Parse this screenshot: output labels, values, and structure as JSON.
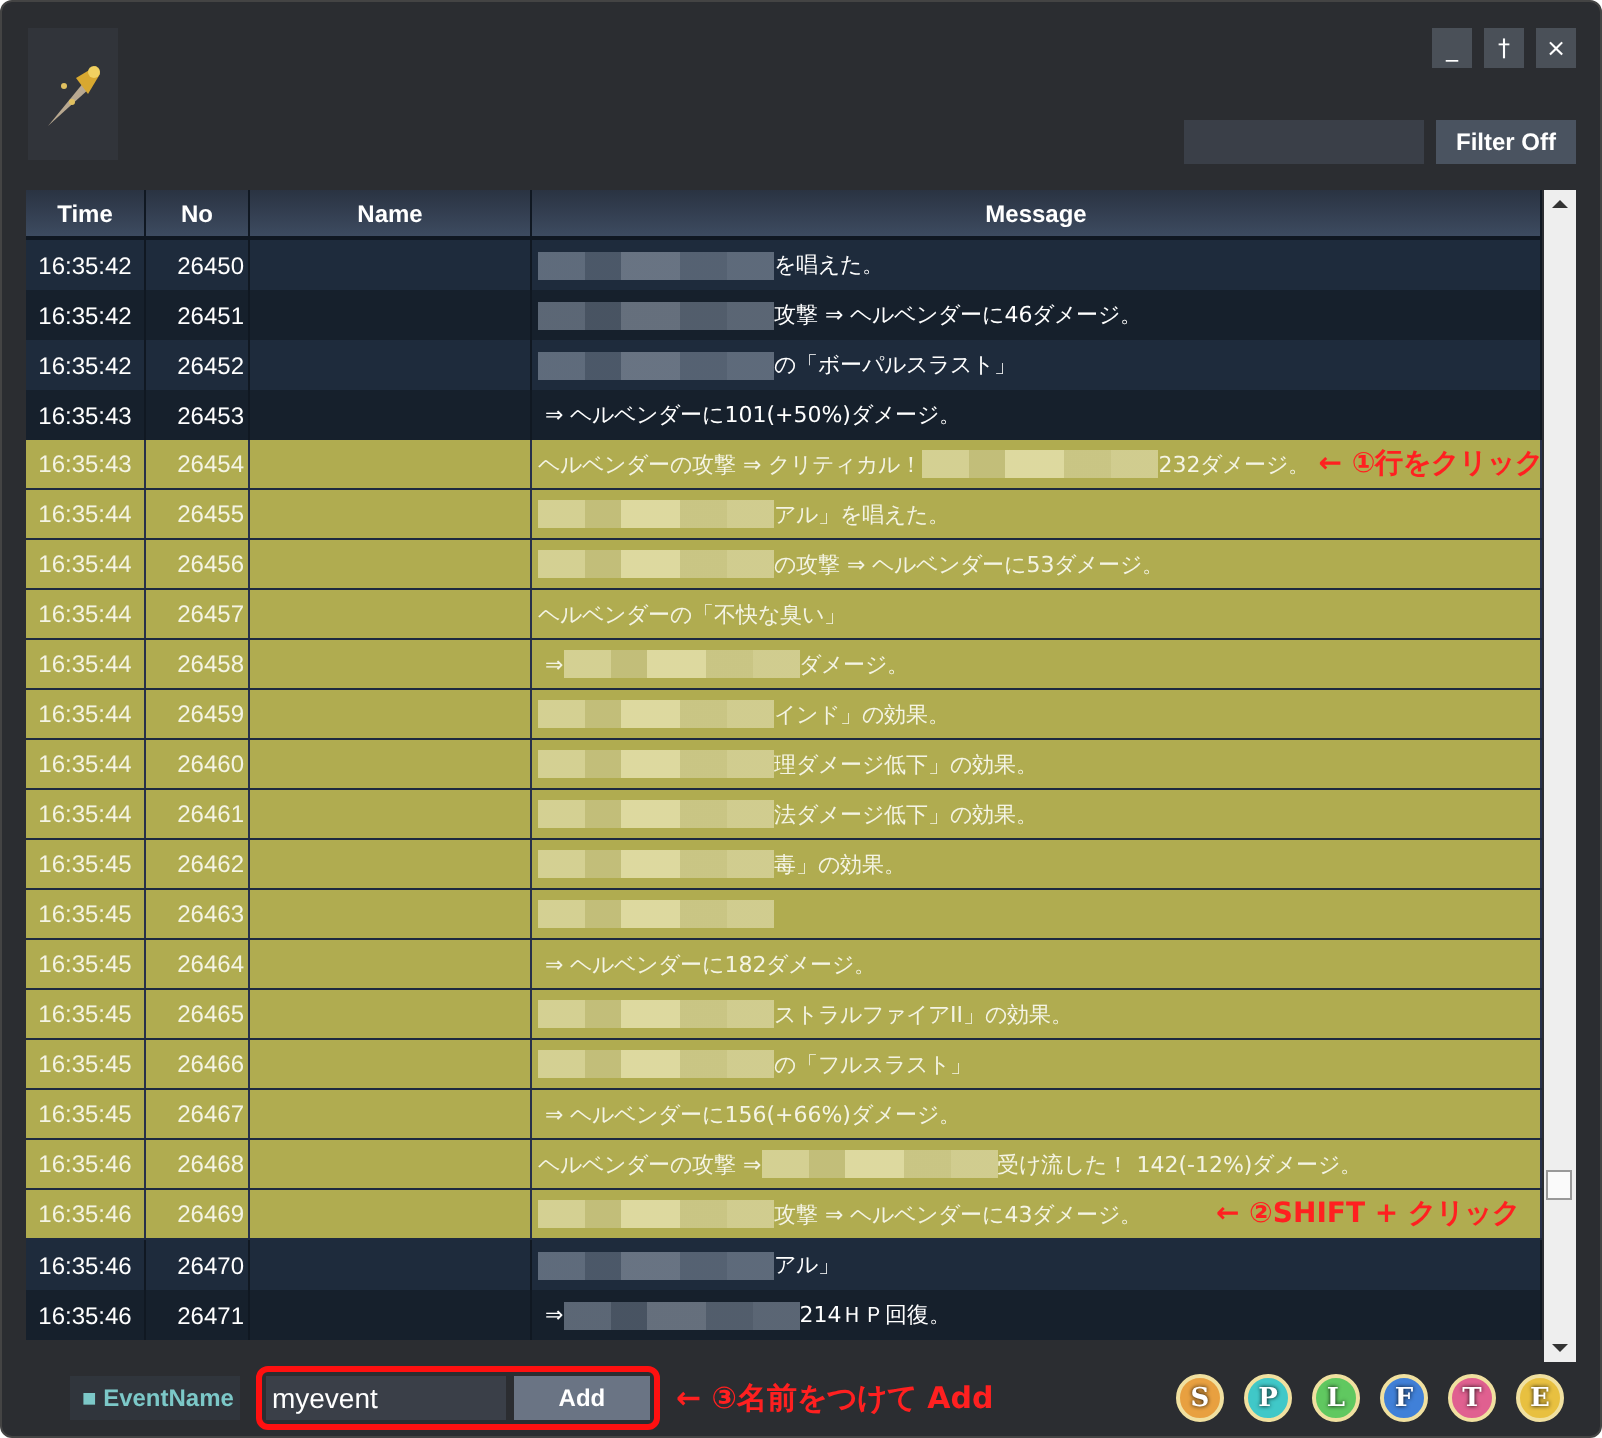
{
  "window": {
    "buttons": [
      "_",
      "†",
      "×"
    ]
  },
  "filter": {
    "button": "Filter Off"
  },
  "table": {
    "columns": [
      "Time",
      "No",
      "Name",
      "Message"
    ],
    "rows": [
      {
        "time": "16:35:42",
        "no": "26450",
        "selected": false,
        "message": [
          {
            "kind": "redacted"
          },
          {
            "kind": "text",
            "text": "を唱えた。"
          }
        ]
      },
      {
        "time": "16:35:42",
        "no": "26451",
        "selected": false,
        "message": [
          {
            "kind": "redacted"
          },
          {
            "kind": "text",
            "text": "攻撃 ⇒ ヘルベンダーに46ダメージ。"
          }
        ]
      },
      {
        "time": "16:35:42",
        "no": "26452",
        "selected": false,
        "message": [
          {
            "kind": "redacted"
          },
          {
            "kind": "text",
            "text": "の「ボーパルスラスト」"
          }
        ]
      },
      {
        "time": "16:35:43",
        "no": "26453",
        "selected": false,
        "message": [
          {
            "kind": "text",
            "text": " ⇒ ヘルベンダーに101(+50%)ダメージ。"
          }
        ]
      },
      {
        "time": "16:35:43",
        "no": "26454",
        "selected": true,
        "message": [
          {
            "kind": "text",
            "text": "ヘルベンダーの攻撃 ⇒ クリティカル！"
          },
          {
            "kind": "redacted"
          },
          {
            "kind": "text",
            "text": "232ダメージ。"
          }
        ],
        "annotation": "← ①行をクリック"
      },
      {
        "time": "16:35:44",
        "no": "26455",
        "selected": true,
        "message": [
          {
            "kind": "redacted"
          },
          {
            "kind": "text",
            "text": "アル」を唱えた。"
          }
        ]
      },
      {
        "time": "16:35:44",
        "no": "26456",
        "selected": true,
        "message": [
          {
            "kind": "redacted"
          },
          {
            "kind": "text",
            "text": "の攻撃 ⇒ ヘルベンダーに53ダメージ。"
          }
        ]
      },
      {
        "time": "16:35:44",
        "no": "26457",
        "selected": true,
        "message": [
          {
            "kind": "text",
            "text": "ヘルベンダーの「不快な臭い」"
          }
        ]
      },
      {
        "time": "16:35:44",
        "no": "26458",
        "selected": true,
        "message": [
          {
            "kind": "text",
            "text": " ⇒"
          },
          {
            "kind": "redacted"
          },
          {
            "kind": "text",
            "text": "ダメージ。"
          }
        ]
      },
      {
        "time": "16:35:44",
        "no": "26459",
        "selected": true,
        "message": [
          {
            "kind": "redacted"
          },
          {
            "kind": "text",
            "text": "インド」の効果。"
          }
        ]
      },
      {
        "time": "16:35:44",
        "no": "26460",
        "selected": true,
        "message": [
          {
            "kind": "redacted"
          },
          {
            "kind": "text",
            "text": "理ダメージ低下」の効果。"
          }
        ]
      },
      {
        "time": "16:35:44",
        "no": "26461",
        "selected": true,
        "message": [
          {
            "kind": "redacted"
          },
          {
            "kind": "text",
            "text": "法ダメージ低下」の効果。"
          }
        ]
      },
      {
        "time": "16:35:45",
        "no": "26462",
        "selected": true,
        "message": [
          {
            "kind": "redacted"
          },
          {
            "kind": "text",
            "text": "毒」の効果。"
          }
        ]
      },
      {
        "time": "16:35:45",
        "no": "26463",
        "selected": true,
        "message": [
          {
            "kind": "redacted"
          }
        ]
      },
      {
        "time": "16:35:45",
        "no": "26464",
        "selected": true,
        "message": [
          {
            "kind": "text",
            "text": " ⇒ ヘルベンダーに182ダメージ。"
          }
        ]
      },
      {
        "time": "16:35:45",
        "no": "26465",
        "selected": true,
        "message": [
          {
            "kind": "redacted"
          },
          {
            "kind": "text",
            "text": "ストラルファイアII」の効果。"
          }
        ]
      },
      {
        "time": "16:35:45",
        "no": "26466",
        "selected": true,
        "message": [
          {
            "kind": "redacted"
          },
          {
            "kind": "text",
            "text": "の「フルスラスト」"
          }
        ]
      },
      {
        "time": "16:35:45",
        "no": "26467",
        "selected": true,
        "message": [
          {
            "kind": "text",
            "text": " ⇒ ヘルベンダーに156(+66%)ダメージ。"
          }
        ]
      },
      {
        "time": "16:35:46",
        "no": "26468",
        "selected": true,
        "message": [
          {
            "kind": "text",
            "text": "ヘルベンダーの攻撃 ⇒"
          },
          {
            "kind": "redacted"
          },
          {
            "kind": "text",
            "text": "受け流した！ 142(-12%)ダメージ。"
          }
        ]
      },
      {
        "time": "16:35:46",
        "no": "26469",
        "selected": true,
        "message": [
          {
            "kind": "redacted"
          },
          {
            "kind": "text",
            "text": "攻撃 ⇒ ヘルベンダーに43ダメージ。"
          }
        ],
        "annotation": "← ②SHIFT + クリック"
      },
      {
        "time": "16:35:46",
        "no": "26470",
        "selected": false,
        "message": [
          {
            "kind": "redacted"
          },
          {
            "kind": "text",
            "text": "アル」"
          }
        ]
      },
      {
        "time": "16:35:46",
        "no": "26471",
        "selected": false,
        "message": [
          {
            "kind": "text",
            "text": " ⇒"
          },
          {
            "kind": "redacted"
          },
          {
            "kind": "text",
            "text": "214ＨＰ回復。"
          }
        ]
      }
    ]
  },
  "bottom": {
    "label": "■ EventName",
    "input_value": "myevent",
    "button": "Add",
    "annotation": "← ③名前をつけて Add",
    "toggles": [
      {
        "letter": "S",
        "color": "#e8a040"
      },
      {
        "letter": "P",
        "color": "#40c8c8"
      },
      {
        "letter": "L",
        "color": "#60c860"
      },
      {
        "letter": "F",
        "color": "#4080d8"
      },
      {
        "letter": "T",
        "color": "#e06090"
      },
      {
        "letter": "E",
        "color": "#e8c040"
      }
    ]
  }
}
